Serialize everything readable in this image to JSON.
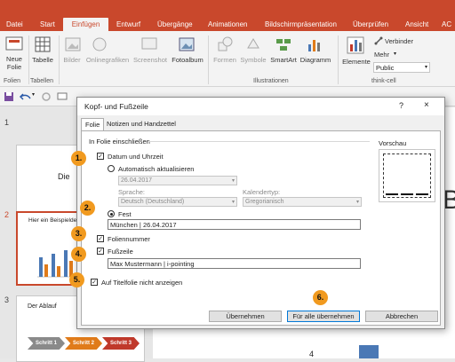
{
  "ribbon_tabs": [
    "Datei",
    "Start",
    "Einfügen",
    "Entwurf",
    "Übergänge",
    "Animationen",
    "Bildschirmpräsentation",
    "Überprüfen",
    "Ansicht",
    "AC"
  ],
  "active_tab": "Einfügen",
  "ribbon": {
    "neue_folie": "Neue\nFolie",
    "tabelle": "Tabelle",
    "bilder": "Bilder",
    "onlinegrafiken": "Onlinegrafiken",
    "screenshot": "Screenshot",
    "fotoalbum": "Fotoalbum",
    "formen": "Formen",
    "symbole": "Symbole",
    "smartart": "SmartArt",
    "diagramm": "Diagramm",
    "elemente": "Elemente",
    "verbinder": "Verbinder",
    "mehr": "Mehr",
    "public": "Public",
    "groups": {
      "folien": "Folien",
      "tabellen": "Tabellen",
      "illustrationen": "Illustrationen",
      "thinkcell": "think-cell"
    }
  },
  "thumbs": {
    "nums": [
      "1",
      "2",
      "3"
    ],
    "slide1_text": "Die",
    "slide2_text": "Hier ein Beispielde",
    "slide3_text": "Der Ablauf",
    "steps": [
      "Schritt 1",
      "Schritt 2",
      "Schritt 3"
    ],
    "step_colors": [
      "#8a8a8a",
      "#e07b1a",
      "#c0392b"
    ]
  },
  "slide": {
    "big_letter": "B",
    "axis_num": "4"
  },
  "dialog": {
    "title": "Kopf- und Fußzeile",
    "help": "?",
    "close": "×",
    "tabs": [
      "Folie",
      "Notizen und Handzettel"
    ],
    "section": "In Folie einschließen",
    "datum": "Datum und Uhrzeit",
    "auto": "Automatisch aktualisieren",
    "auto_date": "26.04.2017",
    "sprache_label": "Sprache:",
    "sprache": "Deutsch (Deutschland)",
    "kalender_label": "Kalendertyp:",
    "kalender": "Gregorianisch",
    "fest": "Fest",
    "fest_value": "München | 26.04.2017",
    "foliennummer": "Foliennummer",
    "fusszeile": "Fußzeile",
    "fusszeile_value": "Max Mustermann | i-pointing",
    "titelfolie": "Auf Titelfolie nicht anzeigen",
    "vorschau": "Vorschau",
    "btn_apply": "Übernehmen",
    "btn_apply_all": "Für alle übernehmen",
    "btn_cancel": "Abbrechen"
  },
  "badges": [
    "1.",
    "2.",
    "3.",
    "4.",
    "5.",
    "6."
  ]
}
